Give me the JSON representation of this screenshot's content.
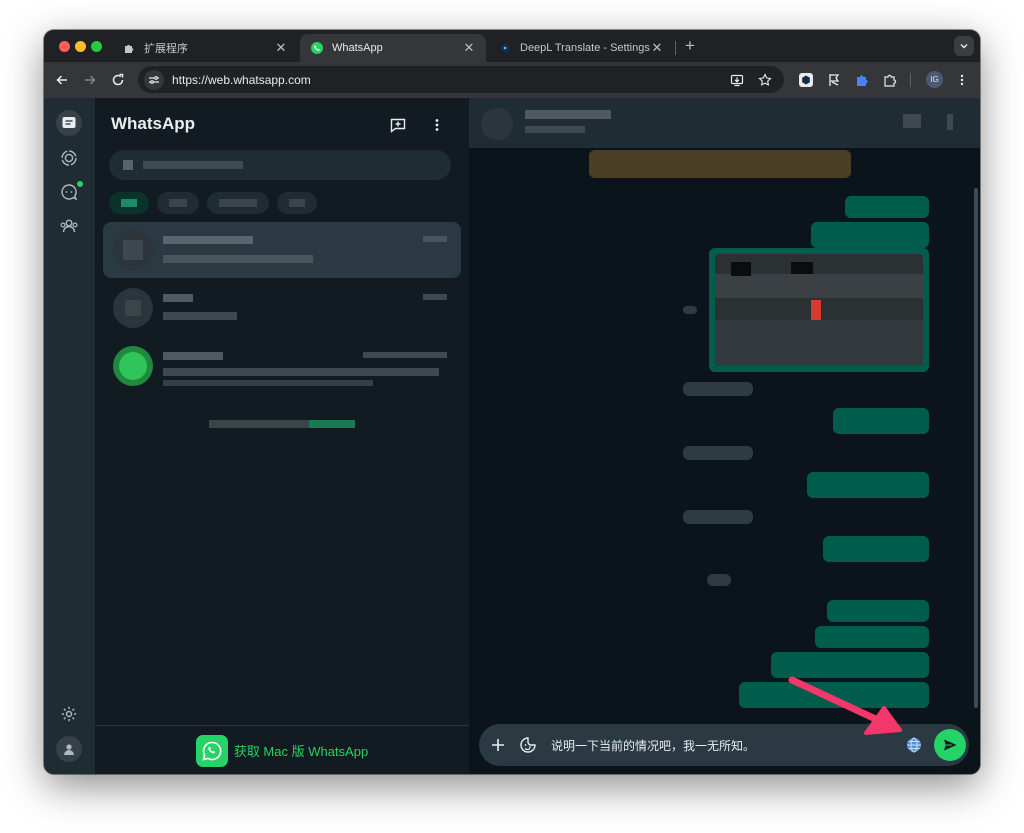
{
  "browser": {
    "tabs": [
      {
        "title": "扩展程序",
        "favicon": "puzzle-icon",
        "active": false
      },
      {
        "title": "WhatsApp",
        "favicon": "whatsapp-icon",
        "active": true
      },
      {
        "title": "DeepL Translate - Settings",
        "favicon": "deepl-icon",
        "active": false
      }
    ],
    "url": "https://web.whatsapp.com",
    "profile_initials": "IG"
  },
  "whatsapp": {
    "app_title": "WhatsApp",
    "get_mac_label": "获取 Mac 版 WhatsApp",
    "composer": {
      "text": "说明一下当前的情况吧，我一无所知。"
    }
  },
  "colors": {
    "accent": "#25d366",
    "outgoing_bubble": "#005c4b",
    "incoming_bubble": "#202c33",
    "annotation_arrow": "#f2386a"
  }
}
